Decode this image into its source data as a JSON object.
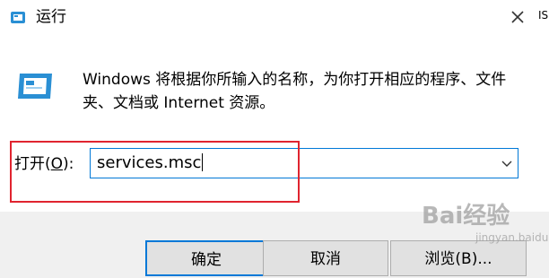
{
  "window": {
    "title": "运行",
    "edge_text": "IS"
  },
  "dialog": {
    "description": "Windows 将根据你所输入的名称，为你打开相应的程序、文件夹、文档或 Internet 资源。",
    "open_label_prefix": "打开(",
    "open_label_key": "O",
    "open_label_suffix": "):",
    "command_value": "services.msc"
  },
  "buttons": {
    "ok": "确定",
    "cancel": "取消",
    "browse": "浏览(B)..."
  },
  "watermark": {
    "text": "Bai经验",
    "sub": "jingyan.baidu.com"
  },
  "colors": {
    "focus_blue": "#0078d7",
    "highlight_red": "#e0242f",
    "icon_blue": "#2a8fd4"
  }
}
